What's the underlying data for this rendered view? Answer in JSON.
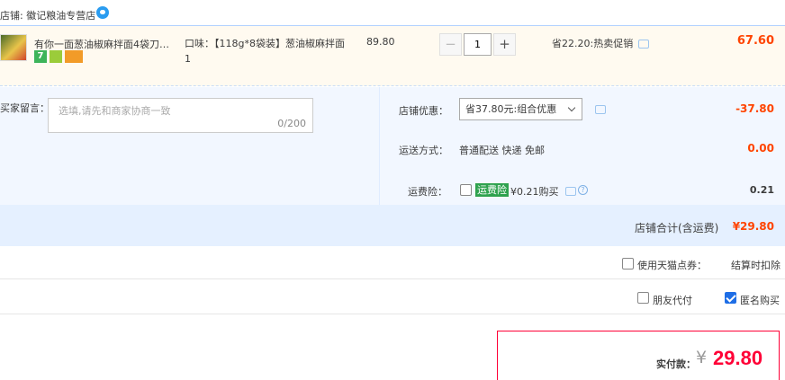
{
  "shop": {
    "name": "店铺: 徽记粮油专营店",
    "icon": "wangwang-chat-icon"
  },
  "item": {
    "title": "有你一面葱油椒麻拌面4袋刀削…",
    "badges": [
      "7",
      "",
      ""
    ],
    "sku": "口味：【118g*8袋装】葱油椒麻拌面1",
    "unit_price": "89.80",
    "quantity": "1",
    "qty_minus": "−",
    "qty_plus": "+",
    "promo": "省22.20:热卖促销",
    "subtotal": "67.60"
  },
  "memo": {
    "label": "买家留言：",
    "placeholder": "选填,请先和商家协商一致",
    "count": "0/200"
  },
  "options": {
    "discount_label": "店铺优惠：",
    "discount_select": "省37.80元:组合优惠",
    "discount_value": "-37.80",
    "shipping_label": "运送方式：",
    "shipping_text": "普通配送 快递 免邮",
    "shipping_value": "0.00",
    "insurance_label": "运费险：",
    "insurance_tag": "运费险",
    "insurance_text": "¥0.21购买",
    "insurance_value": "0.21"
  },
  "shop_total": {
    "label": "店铺合计(含运费)",
    "value": "¥29.80"
  },
  "points": {
    "label": "使用天猫点券：",
    "note": "结算时扣除"
  },
  "extras": {
    "friend_pay": "朋友代付",
    "anonymous": "匿名购买",
    "anonymous_checked": true
  },
  "payment": {
    "label": "实付款：",
    "currency": "¥",
    "value": "29.80"
  },
  "colors": {
    "price_red": "#ff4400",
    "pay_red": "#ff0036",
    "accent_blue": "#1e6ee6"
  }
}
